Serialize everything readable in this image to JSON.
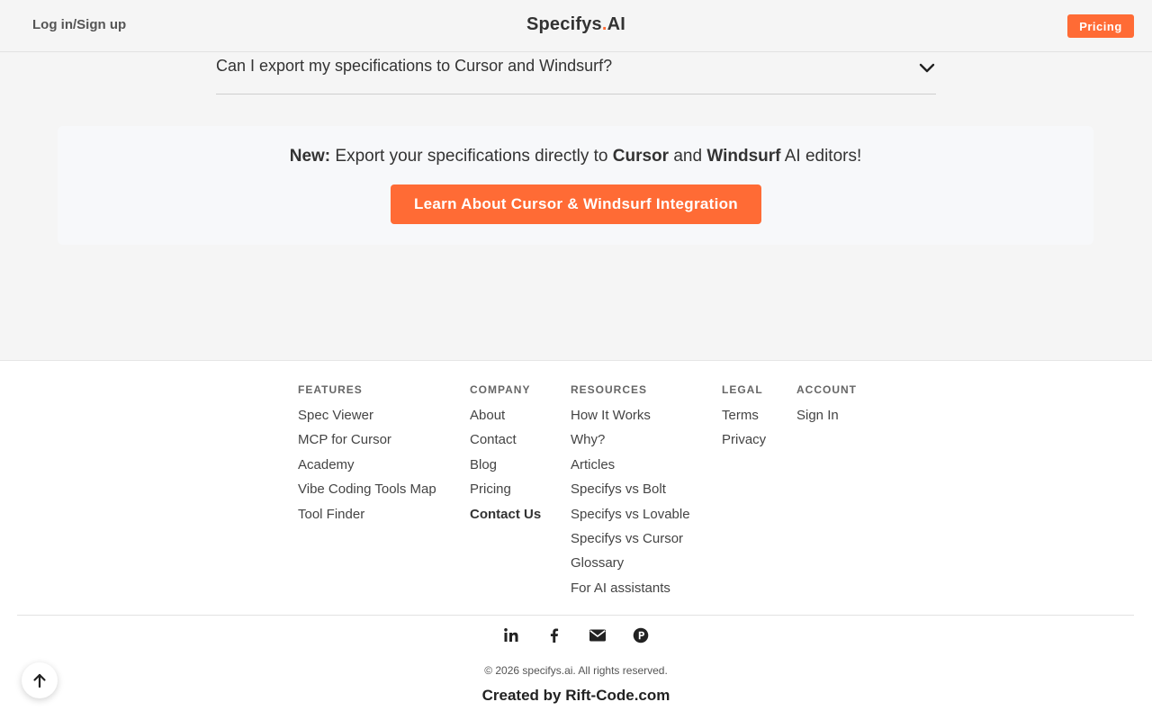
{
  "header": {
    "login_label": "Log in/Sign up",
    "brand_name": "Specifys",
    "brand_dot": ".",
    "brand_suffix": "AI",
    "pricing_label": "Pricing"
  },
  "faq": {
    "question": "Can I export my specifications to Cursor and Windsurf?",
    "chevron_icon": "chevron-down-icon"
  },
  "promo": {
    "new_label": "New:",
    "text_part1": "Export your specifications directly to",
    "cursor": "Cursor",
    "and": "and",
    "windsurf": "Windsurf",
    "text_part2": "AI editors!",
    "button_label": "Learn About Cursor & Windsurf Integration"
  },
  "footer": {
    "columns": [
      {
        "title": "FEATURES",
        "links": [
          "Spec Viewer",
          "MCP for Cursor",
          "Academy",
          "Vibe Coding Tools Map",
          "Tool Finder"
        ]
      },
      {
        "title": "COMPANY",
        "links": [
          "About",
          "Contact",
          "Blog",
          "Pricing",
          "Contact Us"
        ]
      },
      {
        "title": "RESOURCES",
        "links": [
          "How It Works",
          "Why?",
          "Articles",
          "Specifys vs Bolt",
          "Specifys vs Lovable",
          "Specifys vs Cursor",
          "Glossary",
          "For AI assistants"
        ]
      },
      {
        "title": "LEGAL",
        "links": [
          "Terms",
          "Privacy"
        ]
      },
      {
        "title": "ACCOUNT",
        "links": [
          "Sign In"
        ]
      }
    ],
    "social_icons": [
      "linkedin-icon",
      "facebook-icon",
      "envelope-icon",
      "product-hunt-icon"
    ],
    "copyright": "© 2026 specifys.ai. All rights reserved.",
    "created_by": "Created by Rift-Code.com"
  },
  "back_to_top_icon": "arrow-up-icon",
  "colors": {
    "accent": "#ff6b35",
    "text": "#333333",
    "background": "#f5f5f5"
  }
}
